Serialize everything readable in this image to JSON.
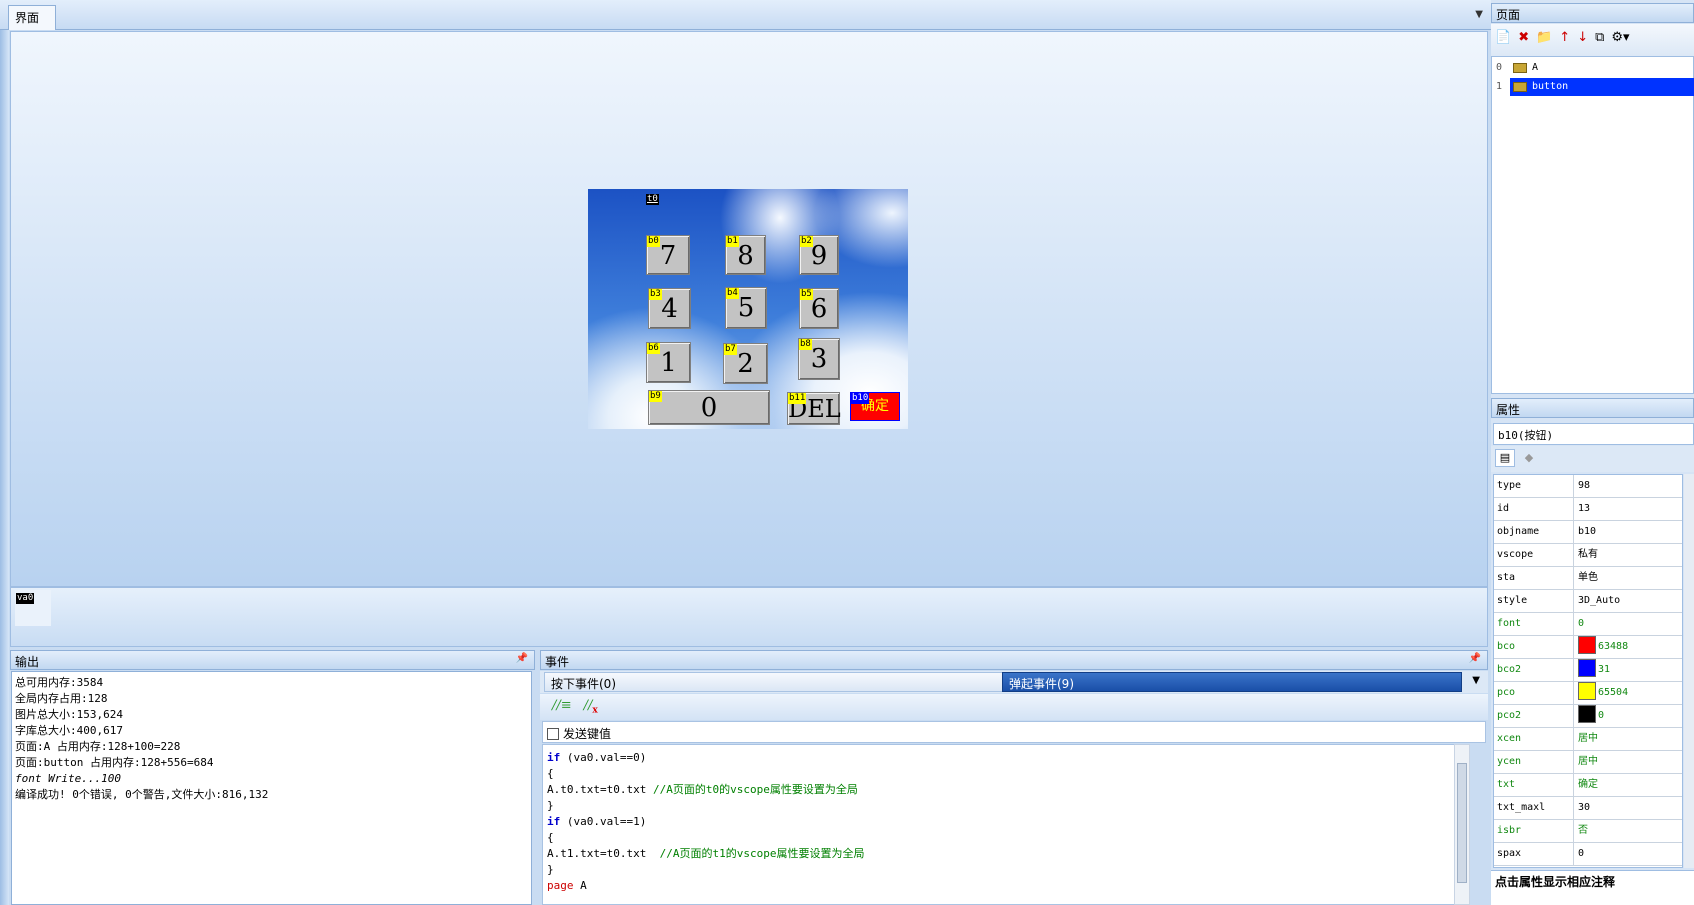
{
  "design_tab": {
    "label": "界面"
  },
  "canvas": {
    "t0_tag": "t0",
    "keys": [
      {
        "tag": "b0",
        "label": "7"
      },
      {
        "tag": "b1",
        "label": "8"
      },
      {
        "tag": "b2",
        "label": "9"
      },
      {
        "tag": "b3",
        "label": "4"
      },
      {
        "tag": "b4",
        "label": "5"
      },
      {
        "tag": "b5",
        "label": "6"
      },
      {
        "tag": "b6",
        "label": "1"
      },
      {
        "tag": "b7",
        "label": "2"
      },
      {
        "tag": "b8",
        "label": "3"
      },
      {
        "tag": "b9",
        "label": "0"
      },
      {
        "tag": "b11",
        "label": "DEL"
      },
      {
        "tag": "b10",
        "label": "确定"
      }
    ]
  },
  "variable_strip": {
    "va0_tag": "va0"
  },
  "output": {
    "title": "输出",
    "lines": [
      "总可用内存:3584",
      "全局内存占用:128",
      "图片总大小:153,624",
      "字库总大小:400,617",
      "页面:A 占用内存:128+100=228",
      "页面:button 占用内存:128+556=684",
      "font Write...100",
      "编译成功! 0个错误, 0个警告,文件大小:816,132"
    ]
  },
  "events": {
    "title": "事件",
    "tab_press": "按下事件(0)",
    "tab_release": "弹起事件(9)",
    "send_key_label": "发送键值",
    "code": {
      "l1_kw": "if",
      "l1_rest": " (va0.val==0)",
      "l2": "{",
      "l3_code": "A.t0.txt=t0.txt ",
      "l3_comment": "//A页面的t0的vscope属性要设置为全局",
      "l4": "}",
      "l5_kw": "if",
      "l5_rest": " (va0.val==1)",
      "l6": "{",
      "l7_code": "A.t1.txt=t0.txt  ",
      "l7_comment": "//A页面的t1的vscope属性要设置为全局",
      "l8": "}",
      "l9_kw": "page",
      "l9_rest": " A"
    }
  },
  "pages": {
    "title": "页面",
    "items": [
      {
        "index": "0",
        "name": "A"
      },
      {
        "index": "1",
        "name": "button"
      }
    ]
  },
  "attributes": {
    "title": "属性",
    "selected_object": "b10(按钮)",
    "rows": [
      {
        "key": "type",
        "value": "98"
      },
      {
        "key": "id",
        "value": "13"
      },
      {
        "key": "objname",
        "value": "b10"
      },
      {
        "key": "vscope",
        "value": "私有"
      },
      {
        "key": "sta",
        "value": "单色"
      },
      {
        "key": "style",
        "value": "3D_Auto"
      },
      {
        "key": "font",
        "value": "0"
      },
      {
        "key": "bco",
        "value": "63488",
        "color": "#ff0000"
      },
      {
        "key": "bco2",
        "value": "31",
        "color": "#0000ff"
      },
      {
        "key": "pco",
        "value": "65504",
        "color": "#ffff00"
      },
      {
        "key": "pco2",
        "value": "0",
        "color": "#000000"
      },
      {
        "key": "xcen",
        "value": "居中"
      },
      {
        "key": "ycen",
        "value": "居中"
      },
      {
        "key": "txt",
        "value": "确定"
      },
      {
        "key": "txt_maxl",
        "value": "30"
      },
      {
        "key": "isbr",
        "value": "否"
      },
      {
        "key": "spax",
        "value": "0"
      }
    ],
    "hint": "点击属性显示相应注释"
  }
}
